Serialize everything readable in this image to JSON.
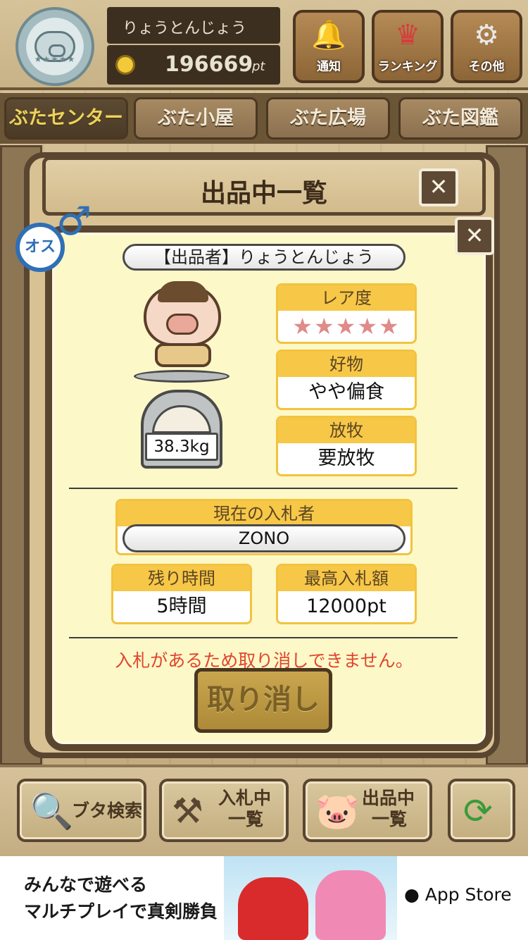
{
  "header": {
    "username": "りょうとんじょう",
    "points": "196669",
    "points_unit": "pt",
    "buttons": [
      {
        "label": "通知",
        "icon": "bell-icon",
        "glyph": "🔔"
      },
      {
        "label": "ランキング",
        "icon": "crown-icon",
        "glyph": "♛"
      },
      {
        "label": "その他",
        "icon": "gear-icon",
        "glyph": "⚙"
      }
    ]
  },
  "tabs": [
    {
      "label": "ぶたセンター",
      "active": true
    },
    {
      "label": "ぶた小屋",
      "active": false
    },
    {
      "label": "ぶた広場",
      "active": false
    },
    {
      "label": "ぶた図鑑",
      "active": false
    }
  ],
  "outer_panel": {
    "title": "出品中一覧",
    "close": "✕"
  },
  "detail": {
    "close": "✕",
    "gender": "オス",
    "gender_symbol": "♂",
    "seller": "【出品者】りょうとんじょう",
    "weight": "38.3kg",
    "rarity_label": "レア度",
    "rarity_stars": "★★★★★",
    "favorite_label": "好物",
    "favorite_value": "やや偏食",
    "grazing_label": "放牧",
    "grazing_value": "要放牧",
    "current_bidder_label": "現在の入札者",
    "current_bidder": "ZONO",
    "time_left_label": "残り時間",
    "time_left": "5時間",
    "highest_bid_label": "最高入札額",
    "highest_bid": "12000pt",
    "warning": "入札があるため取り消しできません。",
    "cancel_label": "取り消し"
  },
  "bottom_bar": {
    "search_label": "ブタ検索",
    "bidding_label_1": "入札中",
    "bidding_label_2": "一覧",
    "listing_label_1": "出品中",
    "listing_label_2": "一覧"
  },
  "ad": {
    "line1": "みんなで遊べる",
    "line2": "マルチプレイで真剣勝負",
    "store": " App Store"
  },
  "colors": {
    "accent_yellow": "#f7c748",
    "warning_red": "#e0452f",
    "wood_dark": "#5a4630",
    "male_blue": "#2f6fb5"
  }
}
